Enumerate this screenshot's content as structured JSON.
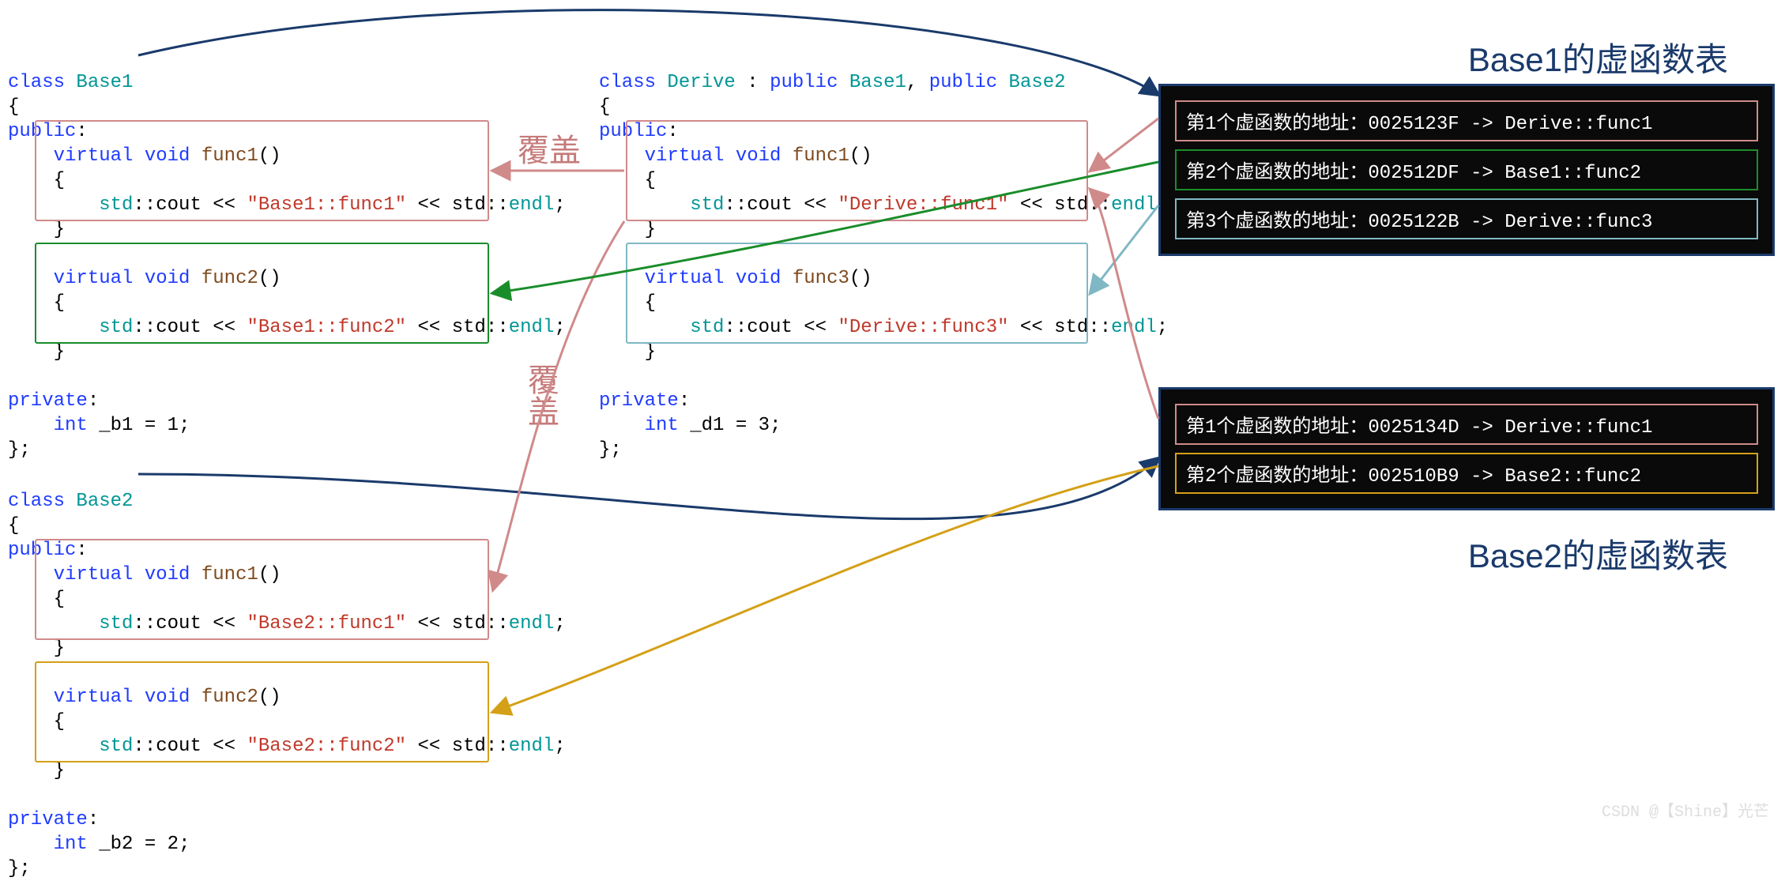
{
  "watermark": "CSDN @【Shine】光芒",
  "annotations": {
    "override1": "覆盖",
    "override2": "覆盖"
  },
  "titles": {
    "vt1": "Base1的虚函数表",
    "vt2": "Base2的虚函数表"
  },
  "base1": {
    "decl_class": "class",
    "name": "Base1",
    "lb": "{",
    "public": "public",
    "colon": ":",
    "func1": {
      "virtual": "virtual",
      "void": "void",
      "name": "func1",
      "paren": "()",
      "lb": "{",
      "body1": "std",
      "body2": "::cout << ",
      "str": "\"Base1::func1\"",
      "body3": " << std::",
      "body4": "endl",
      "body5": ";",
      "rb": "}"
    },
    "func2": {
      "virtual": "virtual",
      "void": "void",
      "name": "func2",
      "paren": "()",
      "lb": "{",
      "body1": "std",
      "body2": "::cout << ",
      "str": "\"Base1::func2\"",
      "body3": " << std::",
      "body4": "endl",
      "body5": ";",
      "rb": "}"
    },
    "private": "private",
    "member": "int _b1 = 1;",
    "rb": "};"
  },
  "base2": {
    "decl_class": "class",
    "name": "Base2",
    "lb": "{",
    "public": "public",
    "colon": ":",
    "func1": {
      "virtual": "virtual",
      "void": "void",
      "name": "func1",
      "paren": "()",
      "lb": "{",
      "body1": "std",
      "body2": "::cout << ",
      "str": "\"Base2::func1\"",
      "body3": " << std::",
      "body4": "endl",
      "body5": ";",
      "rb": "}"
    },
    "func2": {
      "virtual": "virtual",
      "void": "void",
      "name": "func2",
      "paren": "()",
      "lb": "{",
      "body1": "std",
      "body2": "::cout << ",
      "str": "\"Base2::func2\"",
      "body3": " << std::",
      "body4": "endl",
      "body5": ";",
      "rb": "}"
    },
    "private": "private",
    "member": "int _b2 = 2;",
    "rb": "};"
  },
  "derive": {
    "decl_class": "class",
    "name": "Derive",
    "sep": " : ",
    "pub": "public",
    "b1": "Base1",
    "comma": ", ",
    "b2": "Base2",
    "lb": "{",
    "public": "public",
    "colon": ":",
    "func1": {
      "virtual": "virtual",
      "void": "void",
      "name": "func1",
      "paren": "()",
      "lb": "{",
      "body1": "std",
      "body2": "::cout << ",
      "str": "\"Derive::func1\"",
      "body3": " << std::",
      "body4": "endl",
      "body5": ";",
      "rb": "}"
    },
    "func3": {
      "virtual": "virtual",
      "void": "void",
      "name": "func3",
      "paren": "()",
      "lb": "{",
      "body1": "std",
      "body2": "::cout << ",
      "str": "\"Derive::func3\"",
      "body3": " << std::",
      "body4": "endl",
      "body5": ";",
      "rb": "}"
    },
    "private": "private",
    "member": "int _d1 = 3;",
    "rb": "};"
  },
  "vtable1": [
    {
      "text": "第1个虚函数的地址：0025123F -> Derive::func1",
      "color": "#d08a8a"
    },
    {
      "text": "第2个虚函数的地址：002512DF -> Base1::func2",
      "color": "#1a8d2b"
    },
    {
      "text": "第3个虚函数的地址：0025122B -> Derive::func3",
      "color": "#7fb8c4"
    }
  ],
  "vtable2": [
    {
      "text": "第1个虚函数的地址：0025134D -> Derive::func1",
      "color": "#d08a8a"
    },
    {
      "text": "第2个虚函数的地址：002510B9 -> Base2::func2",
      "color": "#d4a017"
    }
  ]
}
